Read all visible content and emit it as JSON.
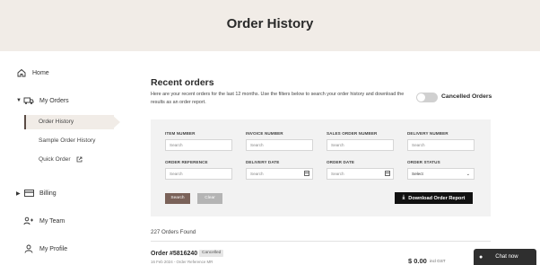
{
  "hero": {
    "title": "Order History"
  },
  "sidebar": {
    "items": [
      {
        "label": "Home",
        "icon": "home-icon"
      },
      {
        "label": "My Orders",
        "icon": "truck-icon",
        "expanded": true
      },
      {
        "label": "Billing",
        "icon": "card-icon",
        "expanded": false
      },
      {
        "label": "My Team",
        "icon": "team-icon"
      },
      {
        "label": "My Profile",
        "icon": "person-icon"
      }
    ],
    "orders_sub": [
      {
        "label": "Order History",
        "active": true
      },
      {
        "label": "Sample Order History"
      },
      {
        "label": "Quick Order",
        "icon": "external-link-icon"
      }
    ]
  },
  "main": {
    "title": "Recent orders",
    "description": "Here are your recent orders for the last 12 months. Use the filters below to search your order history and download the results as an order report.",
    "toggle_label": "Cancelled Orders",
    "toggle_on": false
  },
  "filters": {
    "invoice_number": {
      "label": "INVOICE NUMBER",
      "placeholder": "Search"
    },
    "item_number": {
      "label": "ITEM NUMBER",
      "placeholder": "Search"
    },
    "sales_order_number": {
      "label": "SALES ORDER NUMBER",
      "placeholder": "Search"
    },
    "delivery_number": {
      "label": "DELIVERY NUMBER",
      "placeholder": "Search"
    },
    "order_reference": {
      "label": "ORDER REFERENCE",
      "placeholder": "Search"
    },
    "delivery_date": {
      "label": "DELIVERY DATE",
      "placeholder": "Search"
    },
    "order_date": {
      "label": "ORDER DATE",
      "placeholder": "Search"
    },
    "order_status": {
      "label": "ORDER STATUS",
      "value": "Select"
    },
    "search_label": "Search",
    "clear_label": "Clear",
    "download_label": "Download Order Report"
  },
  "results": {
    "count_text": "227  Orders Found",
    "orders": [
      {
        "number": "Order #5816240",
        "status": "Cancelled",
        "meta": "16 Feb 2024 - Order Reference MR",
        "price": "$ 0.00",
        "gst": "incl GST"
      }
    ]
  },
  "chat": {
    "label": "Chat now"
  },
  "colors": {
    "hero_bg": "#f1ece7",
    "accent_brown": "#7a6259",
    "dark": "#111111"
  }
}
